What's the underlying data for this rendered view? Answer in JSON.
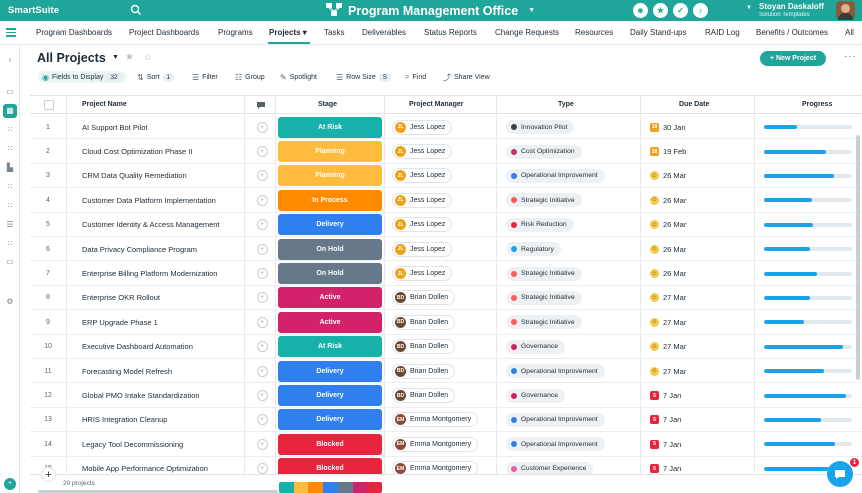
{
  "app": {
    "brand": "SmartSuite",
    "workspace_title": "Program Management Office"
  },
  "user": {
    "name": "Stoyan Daskaloff",
    "subtitle": "Solution Templates"
  },
  "nav": {
    "tabs": [
      "Program Dashboards",
      "Project Dashboards",
      "Programs",
      "Projects",
      "Tasks",
      "Deliverables",
      "Status Reports",
      "Change Requests",
      "Resources",
      "Daily Stand-ups",
      "RAID Log",
      "Benefits / Outcomes",
      "All"
    ],
    "active": "Projects"
  },
  "view": {
    "title": "All Projects",
    "new_button": "+ New Project"
  },
  "toolbar": {
    "fields_label": "Fields to Display",
    "fields_count": "32",
    "sort_label": "Sort",
    "sort_count": "1",
    "filter_label": "Filter",
    "group_label": "Group",
    "spotlight_label": "Spotlight",
    "rowsize_label": "Row Size",
    "rowsize_count": "S",
    "find_label": "Find",
    "share_label": "Share View"
  },
  "columns": {
    "name": "Project Name",
    "stage": "Stage",
    "manager": "Project Manager",
    "type": "Type",
    "due": "Due Date",
    "progress": "Progress"
  },
  "stage_colors": {
    "At Risk": "#16b1a8",
    "Planning": "#ffbb3d",
    "In Process": "#ff8a00",
    "Delivery": "#2f7fef",
    "On Hold": "#66788a",
    "Active": "#d2226a",
    "Blocked": "#e8243e"
  },
  "type_colors": {
    "Innovation Pilot": "#3a4148",
    "Cost Optimization": "#c92a6b",
    "Operational Improvement": "#2f7fef",
    "Strategic Initiative": "#ff5a5a",
    "Risk Reduction": "#e8243e",
    "Regulatory": "#1aa3e8",
    "Governance": "#d2226a",
    "Customer Experience": "#f25aa0"
  },
  "rows": [
    {
      "num": "1",
      "name": "AI Support Bot Pilot",
      "stage": "At Risk",
      "manager": "Jess Lopez",
      "initials": "JL",
      "type": "Innovation Pilot",
      "due": "30 Jan",
      "due_icon": "18",
      "progress": 0.37
    },
    {
      "num": "2",
      "name": "Cloud Cost Optimization Phase II",
      "stage": "Planning",
      "manager": "Jess Lopez",
      "initials": "JL",
      "type": "Cost Optimization",
      "due": "19 Feb",
      "due_icon": "38",
      "progress": 0.71
    },
    {
      "num": "3",
      "name": "CRM Data Quality Remediation",
      "stage": "Planning",
      "manager": "Jess Lopez",
      "initials": "JL",
      "type": "Operational Improvement",
      "due": "26 Mar",
      "due_icon": "smile",
      "progress": 0.79
    },
    {
      "num": "4",
      "name": "Customer Data Platform Implementation",
      "stage": "In Process",
      "manager": "Jess Lopez",
      "initials": "JL",
      "type": "Strategic Initiative",
      "due": "26 Mar",
      "due_icon": "smile",
      "progress": 0.54
    },
    {
      "num": "5",
      "name": "Customer Identity & Access Management",
      "stage": "Delivery",
      "manager": "Jess Lopez",
      "initials": "JL",
      "type": "Risk Reduction",
      "due": "26 Mar",
      "due_icon": "smile",
      "progress": 0.56
    },
    {
      "num": "6",
      "name": "Data Privacy Compliance Program",
      "stage": "On Hold",
      "manager": "Jess Lopez",
      "initials": "JL",
      "type": "Regulatory",
      "due": "26 Mar",
      "due_icon": "smile",
      "progress": 0.52
    },
    {
      "num": "7",
      "name": "Enterprise Billing Platform Modernization",
      "stage": "On Hold",
      "manager": "Jess Lopez",
      "initials": "JL",
      "type": "Strategic Initiative",
      "due": "26 Mar",
      "due_icon": "smile",
      "progress": 0.6
    },
    {
      "num": "8",
      "name": "Enterprise OKR Rollout",
      "stage": "Active",
      "manager": "Brian Dollen",
      "initials": "BD",
      "type": "Strategic Initiative",
      "due": "27 Mar",
      "due_icon": "smile",
      "progress": 0.52
    },
    {
      "num": "9",
      "name": "ERP Upgrade Phase 1",
      "stage": "Active",
      "manager": "Brian Dollen",
      "initials": "BD",
      "type": "Strategic Initiative",
      "due": "27 Mar",
      "due_icon": "smile",
      "progress": 0.45
    },
    {
      "num": "10",
      "name": "Executive Dashboard Automation",
      "stage": "At Risk",
      "manager": "Brian Dollen",
      "initials": "BD",
      "type": "Governance",
      "due": "27 Mar",
      "due_icon": "smile",
      "progress": 0.9
    },
    {
      "num": "11",
      "name": "Forecasting Model Refresh",
      "stage": "Delivery",
      "manager": "Brian Dollen",
      "initials": "BD",
      "type": "Operational Improvement",
      "due": "27 Mar",
      "due_icon": "smile",
      "progress": 0.68
    },
    {
      "num": "12",
      "name": "Global PMO Intake Standardization",
      "stage": "Delivery",
      "manager": "Brian Dollen",
      "initials": "BD",
      "type": "Governance",
      "due": "7 Jan",
      "due_icon": "5",
      "progress": 0.93
    },
    {
      "num": "13",
      "name": "HRIS Integration Cleanup",
      "stage": "Delivery",
      "manager": "Emma Montgomery",
      "initials": "EM",
      "type": "Operational Improvement",
      "due": "7 Jan",
      "due_icon": "5",
      "progress": 0.65
    },
    {
      "num": "14",
      "name": "Legacy Tool Decommissioning",
      "stage": "Blocked",
      "manager": "Emma Montgomery",
      "initials": "EM",
      "type": "Operational Improvement",
      "due": "7 Jan",
      "due_icon": "5",
      "progress": 0.81
    },
    {
      "num": "15",
      "name": "Mobile App Performance Optimization",
      "stage": "Blocked",
      "manager": "Emma Montgomery",
      "initials": "EM",
      "type": "Customer Experience",
      "due": "7 Jan",
      "due_icon": "5",
      "progress": 0.74
    }
  ],
  "footer": {
    "count_label": "20 projects",
    "stage_distribution": [
      "#16b1a8",
      "#ffbb3d",
      "#ff8a00",
      "#2f7fef",
      "#66788a",
      "#d2226a",
      "#e8243e"
    ]
  },
  "chat_badge": "1"
}
